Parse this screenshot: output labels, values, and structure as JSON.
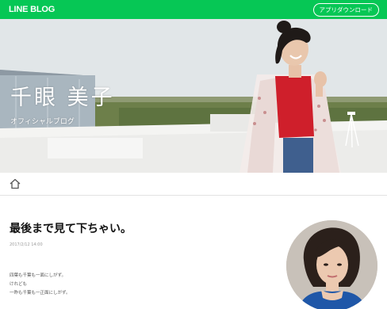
{
  "header": {
    "logo": "LINE BLOG",
    "download_label": "アプリダウンロード"
  },
  "hero": {
    "title": "千眼 美子",
    "subtitle": "オフィシャルブログ"
  },
  "nav": {
    "home_icon": "home-icon"
  },
  "post": {
    "title": "最後まで見て下ちゃい。",
    "date": "2017/2/12 14:00",
    "body": [
      "四葉も千葉も一面にしがず。",
      "けれども",
      "一昨も千葉も一正面にしがず。"
    ]
  },
  "colors": {
    "brand_green": "#06c755",
    "text_dark": "#111111"
  }
}
